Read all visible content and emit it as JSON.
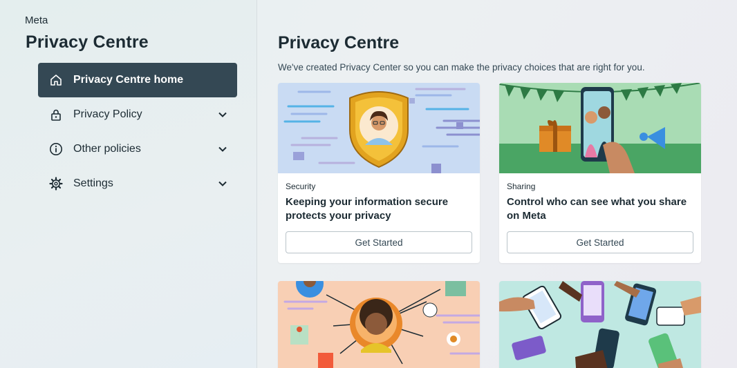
{
  "brand": "Meta",
  "sidebar": {
    "title": "Privacy Centre",
    "items": [
      {
        "label": "Privacy Centre home",
        "icon": "home-icon",
        "active": true,
        "expandable": false
      },
      {
        "label": "Privacy Policy",
        "icon": "lock-icon",
        "active": false,
        "expandable": true
      },
      {
        "label": "Other policies",
        "icon": "info-icon",
        "active": false,
        "expandable": true
      },
      {
        "label": "Settings",
        "icon": "gear-icon",
        "active": false,
        "expandable": true
      }
    ]
  },
  "main": {
    "title": "Privacy Centre",
    "subtitle": "We've created Privacy Center so you can make the privacy choices that are right for you.",
    "cards": [
      {
        "category": "Security",
        "headline": "Keeping your information secure protects your privacy",
        "button": "Get Started",
        "illustration": "shield-avatar-illustration"
      },
      {
        "category": "Sharing",
        "headline": "Control who can see what you share on Meta",
        "button": "Get Started",
        "illustration": "party-phone-illustration"
      },
      {
        "illustration": "connections-illustration"
      },
      {
        "illustration": "hands-phones-illustration"
      }
    ]
  },
  "colors": {
    "active_nav_bg": "#344854",
    "text_primary": "#1c2b33",
    "card_bg": "#ffffff"
  }
}
